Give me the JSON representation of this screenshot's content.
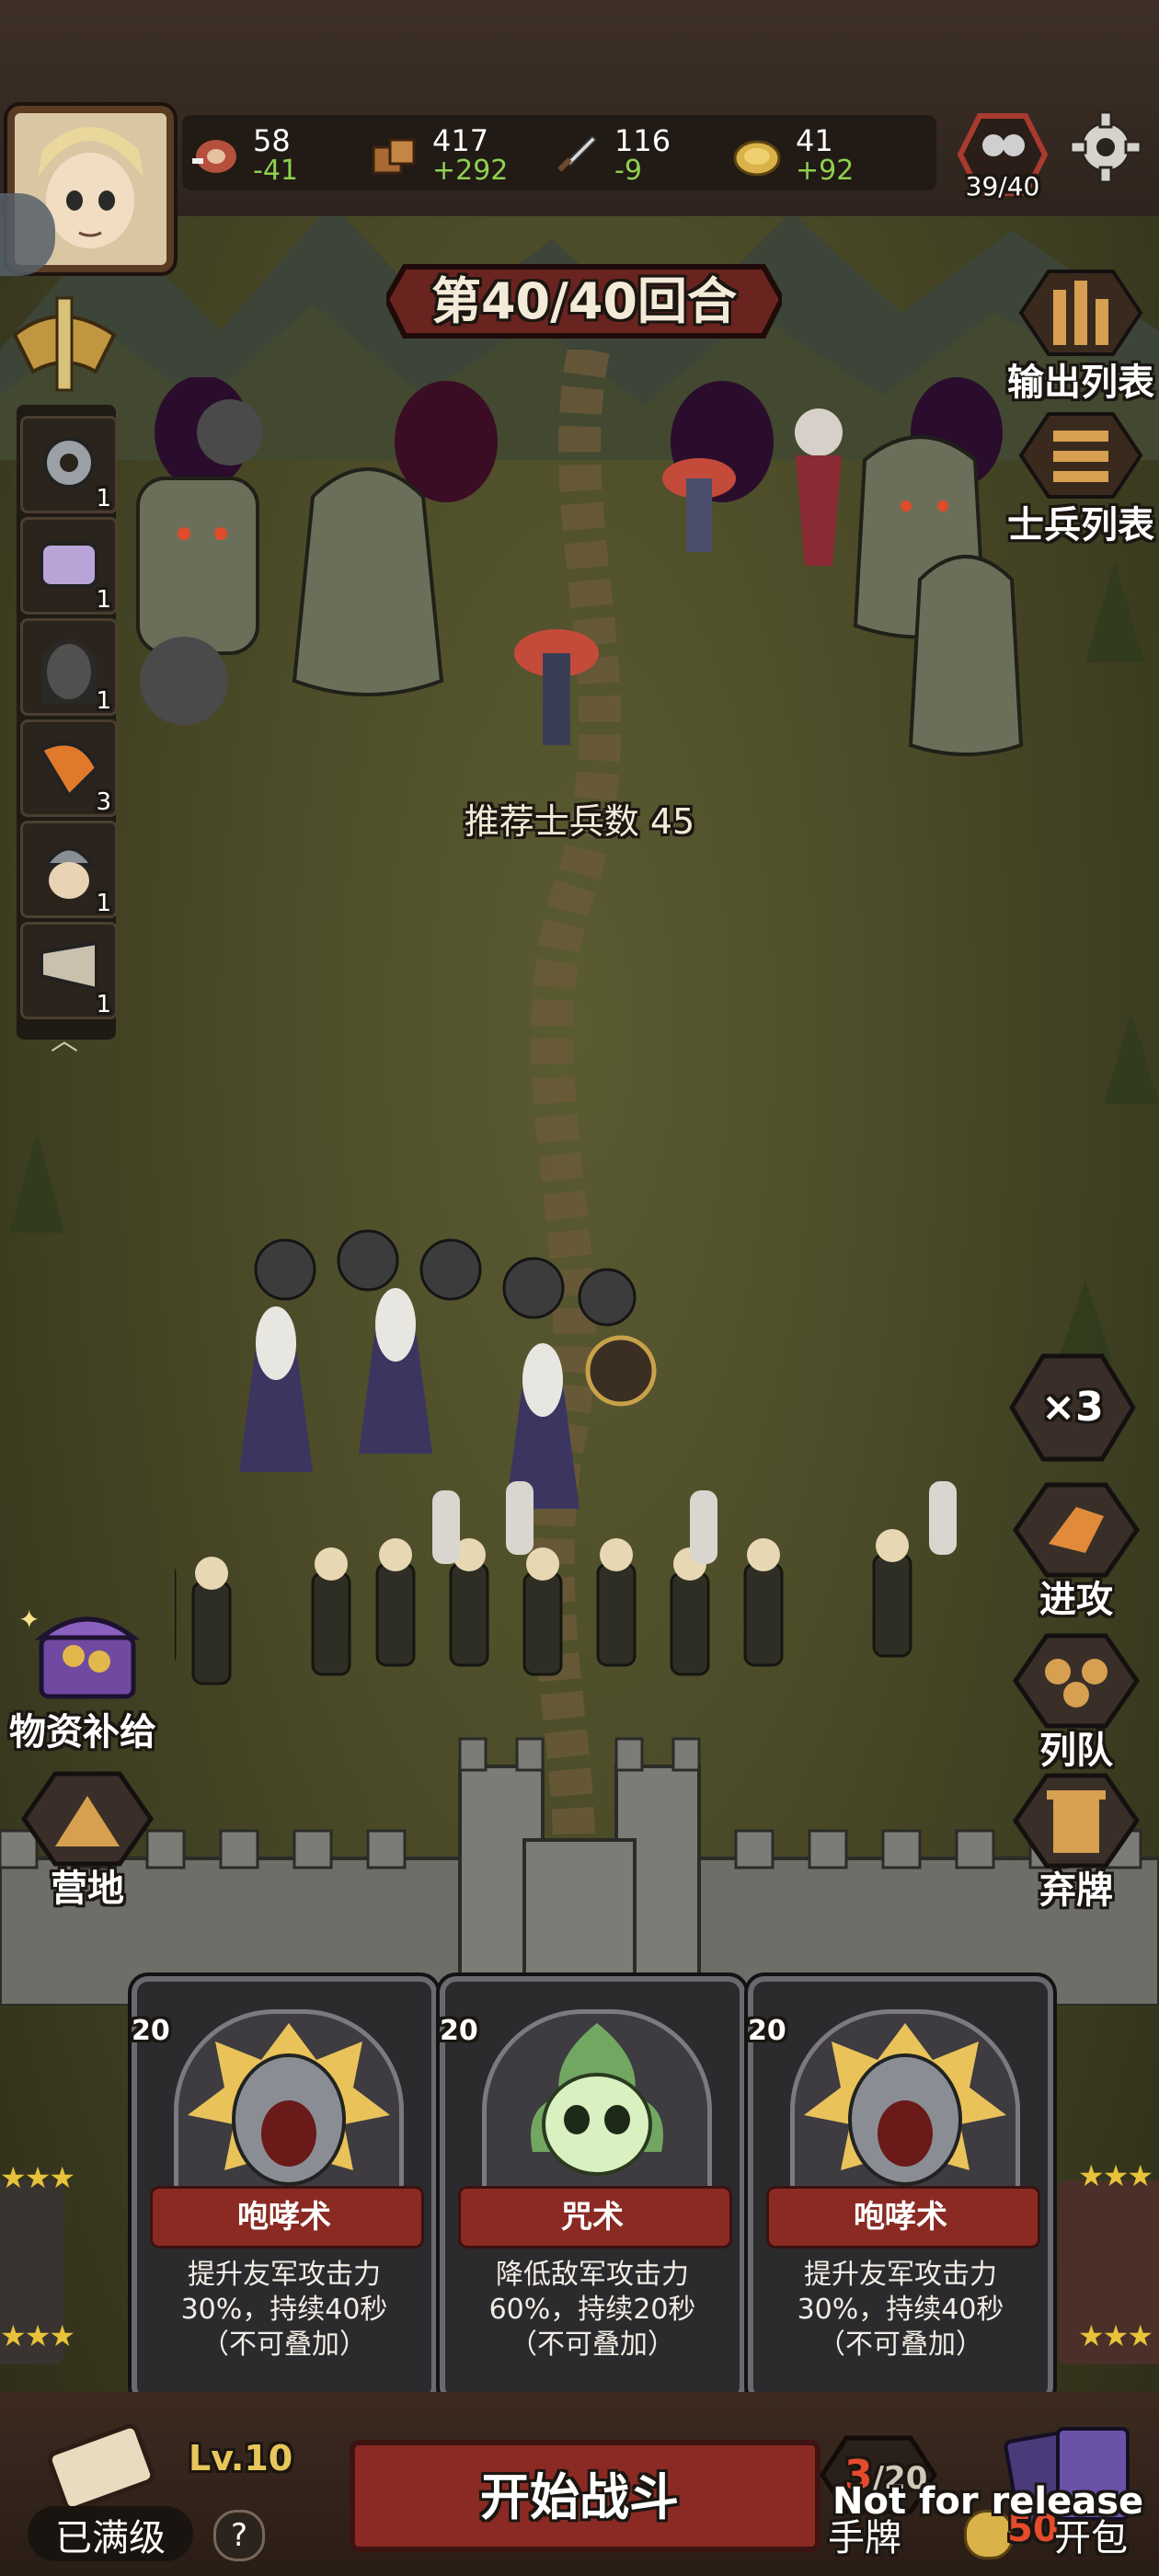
{
  "resources": [
    {
      "icon": "meat-icon",
      "value": "58",
      "delta": "-41"
    },
    {
      "icon": "wood-icon",
      "value": "417",
      "delta": "+292"
    },
    {
      "icon": "sword-icon",
      "value": "116",
      "delta": "-9"
    },
    {
      "icon": "coin-icon",
      "value": "41",
      "delta": "+92"
    }
  ],
  "population": "39/40",
  "round": "第40/40回合",
  "recommended": "推荐士兵数 45",
  "left_slots": [
    {
      "icon": "gear-icon",
      "count": "1"
    },
    {
      "icon": "scroll-icon",
      "count": "1"
    },
    {
      "icon": "nun-icon",
      "count": "1"
    },
    {
      "icon": "axe-icon",
      "count": "3"
    },
    {
      "icon": "viking-icon",
      "count": "1"
    },
    {
      "icon": "horn-icon",
      "count": "1"
    }
  ],
  "right_buttons": {
    "output_list": "输出列表",
    "soldier_list": "士兵列表",
    "speed": "×3",
    "attack": "进攻",
    "formation": "列队",
    "discard": "弃牌"
  },
  "left_buttons": {
    "supply": "物资补给",
    "camp": "营地"
  },
  "cards": [
    {
      "level": "20",
      "name": "咆哮术",
      "desc_lines": [
        "提升友军攻击力",
        "30%，持续40秒",
        "（不可叠加）"
      ],
      "icon": "roar-icon"
    },
    {
      "level": "20",
      "name": "咒术",
      "desc_lines": [
        "降低敌军攻击力",
        "60%，持续20秒",
        "（不可叠加）"
      ],
      "icon": "skull-icon"
    },
    {
      "level": "20",
      "name": "咆哮术",
      "desc_lines": [
        "提升友军攻击力",
        "30%，持续40秒",
        "（不可叠加）"
      ],
      "icon": "roar-icon"
    }
  ],
  "bottom": {
    "level": "Lv.10",
    "maxed": "已满级",
    "help": "?",
    "start": "开始战斗",
    "hand_count": "3",
    "hand_total": "/20",
    "hand_label": "手牌",
    "pack_label": "开包",
    "pack_cost": "50",
    "watermark": "Not for release"
  },
  "colors": {
    "accent_red": "#8b2a24",
    "resource_green": "#8fd14f",
    "gold": "#e8c23a"
  }
}
